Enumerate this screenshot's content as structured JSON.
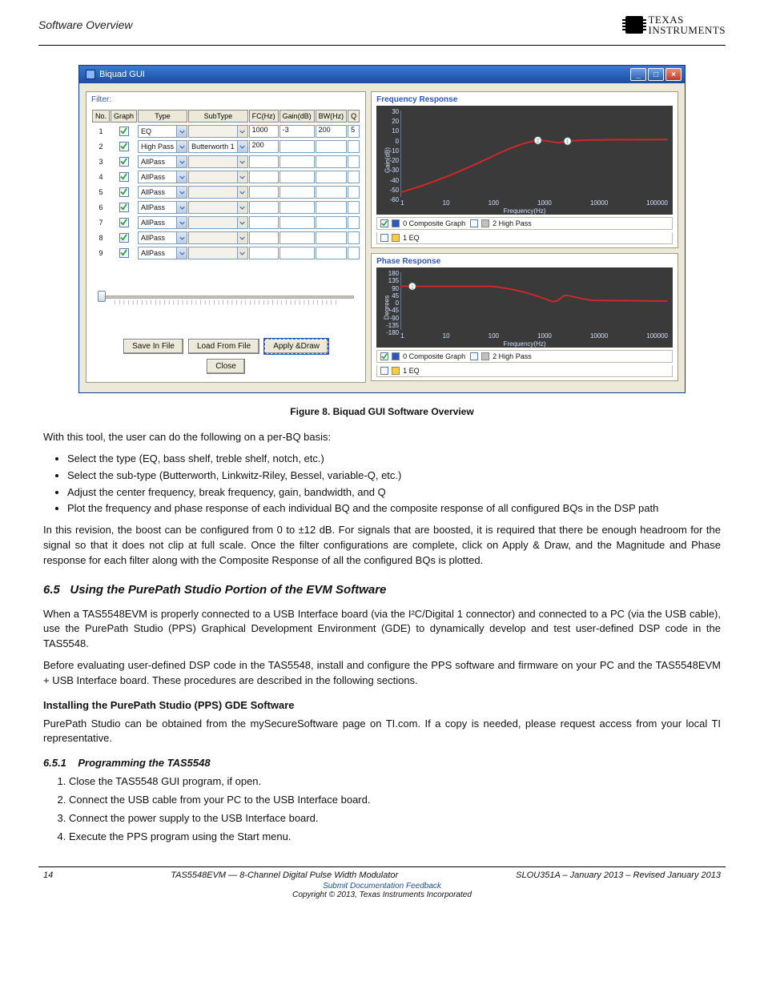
{
  "header": {
    "section_label": "Software Overview",
    "logo_l1": "TEXAS",
    "logo_l2": "INSTRUMENTS"
  },
  "window": {
    "title": "Biquad GUI",
    "min": "_",
    "max": "□",
    "close": "×"
  },
  "filter_panel": {
    "title": "Filter:",
    "headers": [
      "No.",
      "Graph",
      "Type",
      "SubType",
      "FC(Hz)",
      "Gain(dB)",
      "BW(Hz)",
      "Q"
    ],
    "rows": [
      {
        "no": "1",
        "graph": true,
        "type": "EQ",
        "subtype": "",
        "subtype_disabled": true,
        "fc": "1000",
        "gain": "-3",
        "bw": "200",
        "q": "5"
      },
      {
        "no": "2",
        "graph": true,
        "type": "High Pass",
        "subtype": "Butterworth 1",
        "subtype_disabled": false,
        "fc": "200",
        "gain": "",
        "bw": "",
        "q": ""
      },
      {
        "no": "3",
        "graph": true,
        "type": "AllPass",
        "subtype": "",
        "subtype_disabled": true,
        "fc": "",
        "gain": "",
        "bw": "",
        "q": ""
      },
      {
        "no": "4",
        "graph": true,
        "type": "AllPass",
        "subtype": "",
        "subtype_disabled": true,
        "fc": "",
        "gain": "",
        "bw": "",
        "q": ""
      },
      {
        "no": "5",
        "graph": true,
        "type": "AllPass",
        "subtype": "",
        "subtype_disabled": true,
        "fc": "",
        "gain": "",
        "bw": "",
        "q": ""
      },
      {
        "no": "6",
        "graph": true,
        "type": "AllPass",
        "subtype": "",
        "subtype_disabled": true,
        "fc": "",
        "gain": "",
        "bw": "",
        "q": ""
      },
      {
        "no": "7",
        "graph": true,
        "type": "AllPass",
        "subtype": "",
        "subtype_disabled": true,
        "fc": "",
        "gain": "",
        "bw": "",
        "q": ""
      },
      {
        "no": "8",
        "graph": true,
        "type": "AllPass",
        "subtype": "",
        "subtype_disabled": true,
        "fc": "",
        "gain": "",
        "bw": "",
        "q": ""
      },
      {
        "no": "9",
        "graph": true,
        "type": "AllPass",
        "subtype": "",
        "subtype_disabled": true,
        "fc": "",
        "gain": "",
        "bw": "",
        "q": ""
      }
    ],
    "buttons": {
      "save": "Save In File",
      "load": "Load From File",
      "apply": "Apply &Draw",
      "close": "Close"
    }
  },
  "freq_panel": {
    "title": "Frequency Response",
    "y_label": "Gain(dB)",
    "x_label": "Frequency(Hz)",
    "y_ticks": [
      "30",
      "20",
      "10",
      "0",
      "-10",
      "-20",
      "-30",
      "-40",
      "-50",
      "-60"
    ],
    "x_ticks": [
      "1",
      "10",
      "100",
      "1000",
      "10000",
      "100000"
    ],
    "marker_labels": [
      "2",
      "1"
    ],
    "legend": [
      {
        "checked": true,
        "swatch": "#2a56c6",
        "label": "0  Composite Graph"
      },
      {
        "checked": false,
        "swatch": "#c0c0c0",
        "label": "2  High Pass"
      },
      {
        "checked": false,
        "swatch": "#ffcc33",
        "label": "1  EQ"
      }
    ]
  },
  "phase_panel": {
    "title": "Phase Response",
    "y_label": "Degrees",
    "x_label": "Frequency(Hz)",
    "y_ticks": [
      "180",
      "135",
      "90",
      "45",
      "0",
      "-45",
      "-90",
      "-135",
      "-180"
    ],
    "x_ticks": [
      "1",
      "10",
      "100",
      "1000",
      "10000",
      "100000"
    ],
    "marker_labels": [
      "1"
    ],
    "legend": [
      {
        "checked": true,
        "swatch": "#2a56c6",
        "label": "0  Composite Graph"
      },
      {
        "checked": false,
        "swatch": "#c0c0c0",
        "label": "2  High Pass"
      },
      {
        "checked": false,
        "swatch": "#ffcc33",
        "label": "1  EQ"
      }
    ]
  },
  "chart_data": [
    {
      "type": "line",
      "title": "Frequency Response",
      "xlabel": "Frequency(Hz)",
      "ylabel": "Gain(dB)",
      "x_scale": "log",
      "xlim": [
        1,
        100000
      ],
      "ylim": [
        -60,
        30
      ],
      "markers": [
        {
          "label": "2",
          "x": 200,
          "y": -3
        },
        {
          "label": "1",
          "x": 1000,
          "y": -3
        }
      ],
      "series": [
        {
          "name": "Composite Graph",
          "x": [
            1,
            3,
            10,
            30,
            100,
            200,
            500,
            1000,
            3000,
            10000,
            100000
          ],
          "values": [
            -55,
            -45,
            -35,
            -25,
            -13,
            -6,
            -2,
            -3,
            -1,
            0,
            0
          ]
        }
      ]
    },
    {
      "type": "line",
      "title": "Phase Response",
      "xlabel": "Frequency(Hz)",
      "ylabel": "Degrees",
      "x_scale": "log",
      "xlim": [
        1,
        100000
      ],
      "ylim": [
        -180,
        180
      ],
      "markers": [
        {
          "label": "1",
          "x": 3,
          "y": 90
        }
      ],
      "series": [
        {
          "name": "Composite Graph",
          "x": [
            1,
            10,
            50,
            100,
            200,
            500,
            800,
            1000,
            1200,
            2000,
            10000,
            100000
          ],
          "values": [
            90,
            90,
            85,
            75,
            50,
            20,
            0,
            10,
            28,
            10,
            2,
            0
          ]
        }
      ]
    }
  ],
  "figure_caption": "Figure 8. Biquad GUI Software Overview",
  "body": {
    "p_intro": "With this tool, the user can do the following on a per-BQ basis:",
    "bullets": [
      "Select the type (EQ, bass shelf, treble shelf, notch, etc.)",
      "Select the sub-type (Butterworth, Linkwitz-Riley, Bessel, variable-Q, etc.)",
      "Adjust the center frequency, break frequency, gain, bandwidth, and Q",
      "Plot the frequency and phase response of each individual BQ and the composite response of all configured BQs in the DSP path"
    ],
    "p_boost": "In this revision, the boost can be configured from 0 to ±12 dB. For signals that are boosted, it is required that there be enough headroom for the signal so that it does not clip at full scale. Once the filter configurations are complete, click on Apply & Draw, and the Magnitude and Phase response for each filter along with the Composite Response of all the configured BQs is plotted.",
    "sec_num": "6.5",
    "sec_title": "Using the PurePath Studio Portion of the EVM Software",
    "p_pps": "When a TAS5548EVM is properly connected to a USB Interface board (via the I²C/Digital 1 connector) and connected to a PC (via the USB cable), use the PurePath Studio (PPS) Graphical Development Environment (GDE) to dynamically develop and test user-defined DSP code in the TAS5548.",
    "p_pps2": "Before evaluating user-defined DSP code in the TAS5548, install and configure the PPS software and firmware on your PC and the TAS5548EVM + USB Interface board. These procedures are described in the following sections.",
    "sub1": "Installing the PurePath Studio (PPS) GDE Software",
    "p_inst": "PurePath Studio can be obtained from the mySecureSoftware page on TI.com. If a copy is needed, please request access from your local TI representative.",
    "sub2_num": "6.5.1",
    "sub2_title": "Programming the TAS5548",
    "ol": [
      "Close the TAS5548 GUI program, if open.",
      "Connect the USB cable from your PC to the USB Interface board.",
      "Connect the power supply to the USB Interface board.",
      "Execute the PPS program using the Start menu."
    ]
  },
  "footer": {
    "page": "14",
    "doc_title": "TAS5548EVM — 8-Channel Digital Pulse Width Modulator",
    "doc_id": "SLOU351A – January 2013 – Revised January 2013",
    "submit_link": "Submit Documentation Feedback",
    "copyright": "Copyright © 2013, Texas Instruments Incorporated"
  }
}
